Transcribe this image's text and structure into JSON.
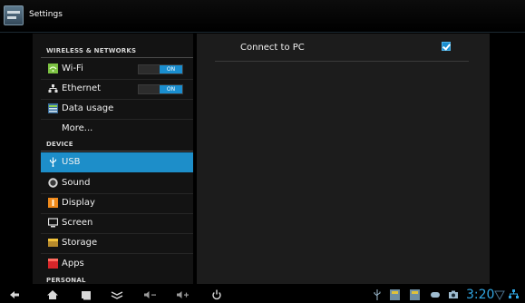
{
  "app": {
    "title": "Settings",
    "icon": "settings-icon"
  },
  "sidebar": {
    "categories": [
      {
        "label": "WIRELESS & NETWORKS"
      },
      {
        "label": "DEVICE"
      },
      {
        "label": "PERSONAL"
      }
    ],
    "items": [
      {
        "label": "Wi-Fi",
        "icon": "wifi-icon",
        "toggle": "ON"
      },
      {
        "label": "Ethernet",
        "icon": "ethernet-icon",
        "toggle": "ON"
      },
      {
        "label": "Data usage",
        "icon": "data-usage-icon"
      },
      {
        "label": "More..."
      },
      {
        "label": "USB",
        "icon": "usb-icon",
        "selected": true
      },
      {
        "label": "Sound",
        "icon": "sound-icon"
      },
      {
        "label": "Display",
        "icon": "display-icon"
      },
      {
        "label": "Screen",
        "icon": "screen-icon"
      },
      {
        "label": "Storage",
        "icon": "storage-icon"
      },
      {
        "label": "Apps",
        "icon": "apps-icon"
      }
    ]
  },
  "detail": {
    "preference": {
      "label": "Connect to PC",
      "checked": true
    }
  },
  "navbar": {
    "buttons": [
      "back-icon",
      "home-icon",
      "recent-apps-icon",
      "menu-icon",
      "volume-down-icon",
      "volume-up-icon",
      "power-icon"
    ],
    "status_icons": [
      "usb-status-icon",
      "notification-icon",
      "notification-icon",
      "gamepad-icon",
      "camera-icon"
    ],
    "clock": "3:20"
  },
  "colors": {
    "accent": "#1d8ec9",
    "background": "#000000",
    "panel": "#131313",
    "clock": "#31a7e4"
  }
}
